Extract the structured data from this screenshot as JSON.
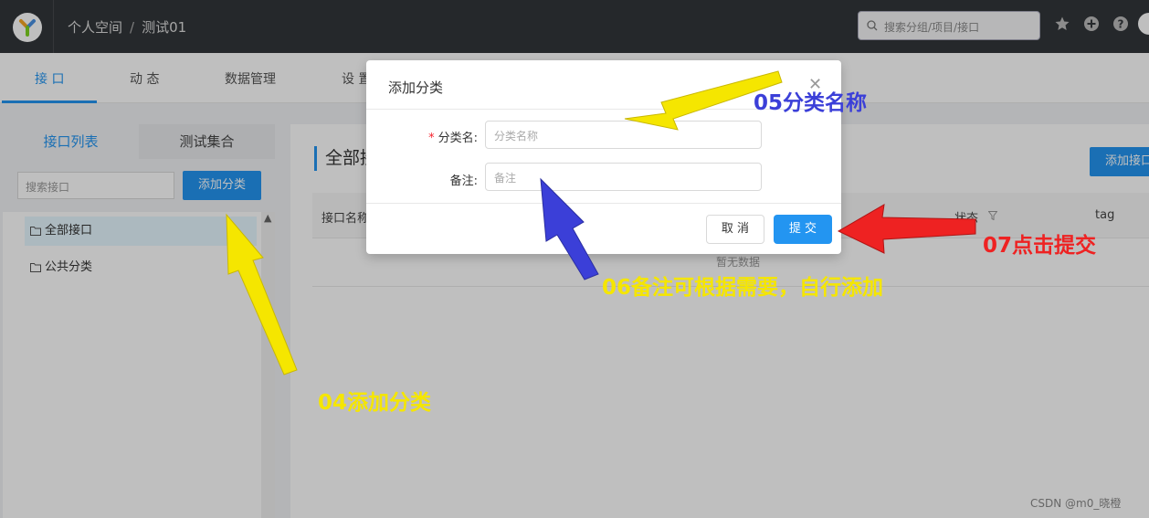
{
  "header": {
    "breadcrumb": [
      "个人空间",
      "测试01"
    ],
    "breadcrumb_sep": "/",
    "search_placeholder": "搜索分组/项目/接口"
  },
  "nav": {
    "tabs": [
      "接 口",
      "动 态",
      "数据管理",
      "设 置"
    ]
  },
  "sidebar": {
    "tabs": [
      "接口列表",
      "测试集合"
    ],
    "search_placeholder": "搜索接口",
    "add_category_label": "添加分类",
    "tree": [
      "全部接口",
      "公共分类"
    ]
  },
  "main": {
    "title": "全部接口",
    "add_button": "添加接口",
    "columns": [
      "接口名称",
      "状态",
      "tag"
    ],
    "empty_text": "暂无数据"
  },
  "modal": {
    "title": "添加分类",
    "name_label": "分类名:",
    "name_placeholder": "分类名称",
    "desc_label": "备注:",
    "desc_placeholder": "备注",
    "cancel_label": "取 消",
    "submit_label": "提 交"
  },
  "annotations": {
    "a04": "04添加分类",
    "a05": "05分类名称",
    "a06": "06备注可根据需要，自行添加",
    "a07": "07点击提交"
  },
  "watermark": "CSDN @m0_晓橙",
  "colors": {
    "primary": "#2395f1",
    "topbar": "#32363a",
    "annotation_yellow": "#f5e600",
    "annotation_blue": "#3b3fd8",
    "annotation_red": "#ee2222"
  }
}
